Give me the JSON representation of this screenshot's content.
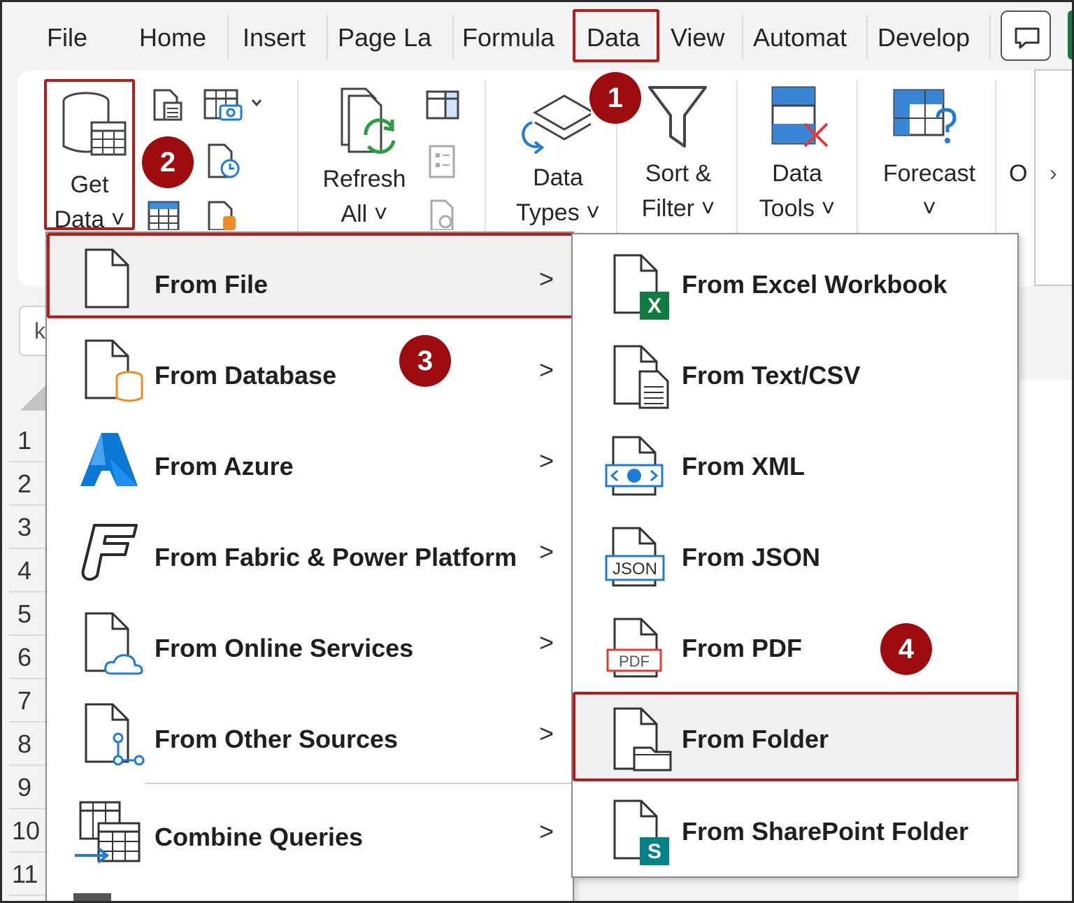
{
  "tabs": [
    {
      "label": "File"
    },
    {
      "label": "Home"
    },
    {
      "label": "Insert"
    },
    {
      "label": "Page La"
    },
    {
      "label": "Formula"
    },
    {
      "label": "Data"
    },
    {
      "label": "View"
    },
    {
      "label": "Automat"
    },
    {
      "label": "Develop"
    }
  ],
  "ribbon": {
    "get_data_line1": "Get",
    "get_data_line2": "Data ˅",
    "refresh_line1": "Refresh",
    "refresh_line2": "All ˅",
    "data_types_line1": "Data",
    "data_types_line2": "Types ˅",
    "sort_filter_line1": "Sort &",
    "sort_filter_line2": "Filter ˅",
    "data_tools_line1": "Data",
    "data_tools_line2": "Tools ˅",
    "forecast_line1": "Forecast",
    "forecast_line2": "˅",
    "outline_partial": "O",
    "more": "›"
  },
  "namebox_partial": "k",
  "row_numbers": [
    "1",
    "2",
    "3",
    "4",
    "5",
    "6",
    "7",
    "8",
    "9",
    "10",
    "11"
  ],
  "left_menu": [
    {
      "label": "From File"
    },
    {
      "label": "From Database"
    },
    {
      "label": "From Azure"
    },
    {
      "label": "From Fabric & Power Platform"
    },
    {
      "label": "From Online Services"
    },
    {
      "label": "From Other Sources"
    },
    {
      "label": "Combine Queries"
    }
  ],
  "right_menu": [
    {
      "label": "From Excel Workbook"
    },
    {
      "label": "From Text/CSV"
    },
    {
      "label": "From XML"
    },
    {
      "label": "From JSON"
    },
    {
      "label": "From PDF"
    },
    {
      "label": "From Folder"
    },
    {
      "label": "From SharePoint Folder"
    }
  ],
  "chevron": ">",
  "icon_text": {
    "excel": "X",
    "json": "JSON",
    "pdf": "PDF",
    "sharepoint": "S"
  },
  "badges": [
    "1",
    "2",
    "3",
    "4"
  ],
  "colors": {
    "highlight": "#b71c1c",
    "badge": "#9e0b0f",
    "excel": "#107c41",
    "azure": "#0a78d4",
    "sharepoint": "#038387",
    "database": "#f08a24"
  }
}
